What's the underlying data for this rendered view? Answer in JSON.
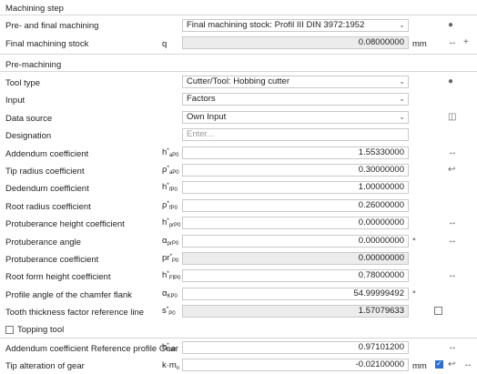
{
  "sections": {
    "machining_step": "Machining step",
    "pre_machining": "Pre-machining"
  },
  "rows": {
    "pre_final": {
      "label": "Pre- and final machining",
      "value": "Final machining stock: Profil III DIN 3972:1952"
    },
    "final_stock": {
      "label": "Final machining stock",
      "symbol": "q",
      "value": "0.08000000",
      "unit": "mm"
    },
    "tool_type": {
      "label": "Tool type",
      "value": "Cutter/Tool: Hobbing cutter"
    },
    "input": {
      "label": "Input",
      "value": "Factors"
    },
    "data_source": {
      "label": "Data source",
      "value": "Own Input"
    },
    "designation": {
      "label": "Designation",
      "placeholder": "Enter..."
    },
    "addendum": {
      "label": "Addendum coefficient",
      "value": "1.55330000"
    },
    "tip_radius": {
      "label": "Tip radius coefficient",
      "value": "0.30000000"
    },
    "dedendum": {
      "label": "Dedendum coefficient",
      "value": "1.00000000"
    },
    "root_radius": {
      "label": "Root radius coefficient",
      "value": "0.26000000"
    },
    "prot_height": {
      "label": "Protuberance height coefficient",
      "value": "0.00000000"
    },
    "prot_angle": {
      "label": "Protuberance angle",
      "value": "0.00000000",
      "unit": "°"
    },
    "prot_coeff": {
      "label": "Protuberance coefficient",
      "value": "0.00000000"
    },
    "root_form": {
      "label": "Root form height coefficient",
      "value": "0.78000000"
    },
    "chamfer": {
      "label": "Profile angle of the chamfer flank",
      "value": "54.99999492",
      "unit": "°"
    },
    "thickness": {
      "label": "Tooth thickness factor reference line",
      "value": "1.57079633"
    },
    "topping": {
      "label": "Topping tool"
    },
    "add_ref": {
      "label": "Addendum coefficient Reference profile Gear",
      "value": "0.97101200"
    },
    "tip_alt": {
      "label": "Tip alteration of gear",
      "value": "-0.02100000",
      "unit": "mm"
    }
  },
  "icons": [
    "chevron-down-icon",
    "lightbulb-icon",
    "link-icon",
    "plus-icon",
    "database-icon",
    "undo-arrow-icon",
    "checkbox"
  ]
}
